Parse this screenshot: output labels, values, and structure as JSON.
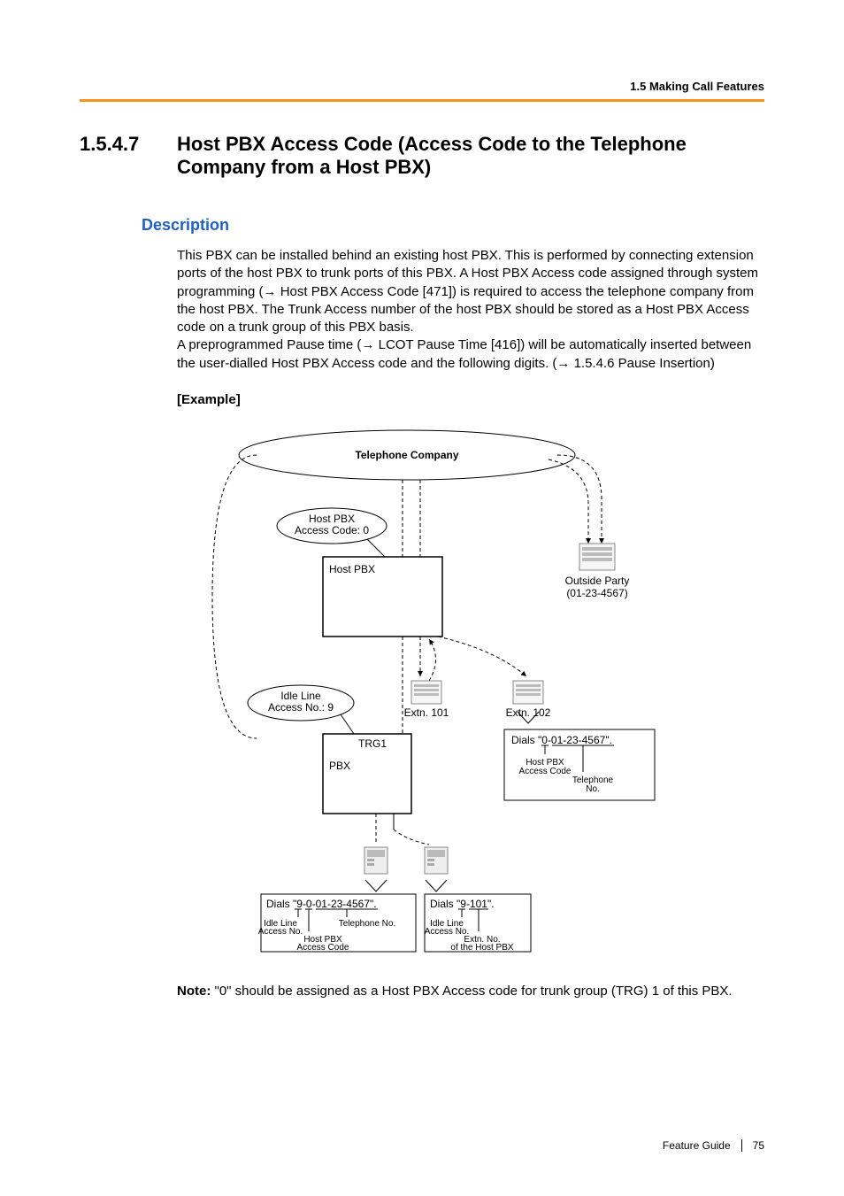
{
  "header": {
    "running": "1.5 Making Call Features"
  },
  "section": {
    "number": "1.5.4.7",
    "title": "Host PBX Access Code (Access Code to the Telephone Company from a Host PBX)"
  },
  "description_heading": "Description",
  "body_html": "This PBX can be installed behind an existing host PBX. This is performed by connecting extension ports of the host PBX to trunk ports of this PBX. A Host PBX Access code assigned through system programming (→ Host PBX Access Code [471]) is required to access the telephone company from the host PBX. The Trunk Access number of the host PBX should be stored as a Host PBX Access code on a trunk group of this PBX basis.<br>A preprogrammed Pause time (→ LCOT Pause Time [416]) will be automatically inserted between the user-dialled Host PBX Access code and the following digits. (→ 1.5.4.6 Pause Insertion)",
  "example_label": "[Example]",
  "diagram": {
    "telco": "Telephone Company",
    "host_pbx_code": {
      "line1": "Host PBX",
      "line2": "Access Code: 0"
    },
    "host_pbx": "Host PBX",
    "outside_party": {
      "line1": "Outside Party",
      "line2": "(01-23-4567)"
    },
    "idle_line": {
      "line1": "Idle Line",
      "line2": "Access No.: 9"
    },
    "extn101": "Extn. 101",
    "extn102": "Extn. 102",
    "trg1": "TRG1",
    "pbx": "PBX",
    "dials_right": "Dials \"0-01-23-4567\".",
    "dials_right_sub1": "Host PBX\nAccess Code",
    "dials_right_sub2": "Telephone\nNo.",
    "dials_left_a": "Dials \"9-0-01-23-4567\".",
    "dials_left_b": "Dials \"9-101\".",
    "label_idle1": "Idle Line\nAccess No.",
    "label_tel_no": "Telephone No.",
    "label_host_code": "Host PBX\nAccess Code",
    "label_idle2": "Idle Line\nAccess No.",
    "label_extn_host": "Extn. No.\nof the Host PBX"
  },
  "note": {
    "label": "Note:",
    "text": " \"0\" should be assigned as a Host PBX Access code for trunk group (TRG) 1 of this PBX."
  },
  "footer": {
    "guide": "Feature Guide",
    "page": "75"
  }
}
